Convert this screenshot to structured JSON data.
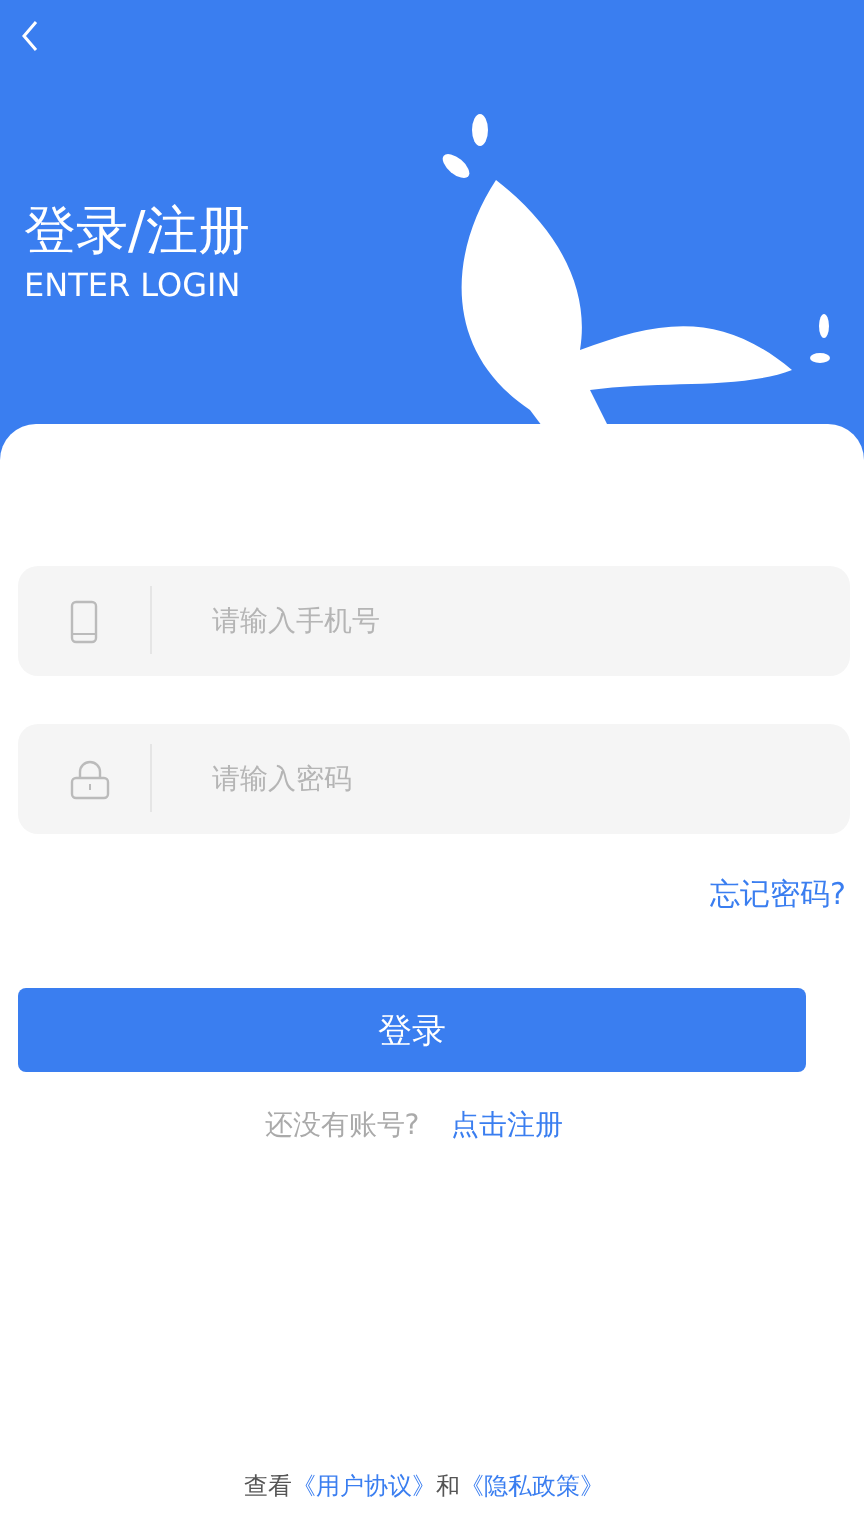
{
  "header": {
    "title": "登录/注册",
    "subtitle": "ENTER LOGIN"
  },
  "fields": [
    {
      "kind": "phone",
      "placeholder": "请输入手机号"
    },
    {
      "kind": "password",
      "placeholder": "请输入密码"
    }
  ],
  "forgot_link": "忘记密码?",
  "login_button": "登录",
  "register": {
    "prompt": "还没有账号?",
    "link": "点击注册"
  },
  "footer": {
    "prefix": "查看",
    "links": [
      "《用户协议》",
      "《隐私政策》"
    ],
    "joiner": "和"
  }
}
